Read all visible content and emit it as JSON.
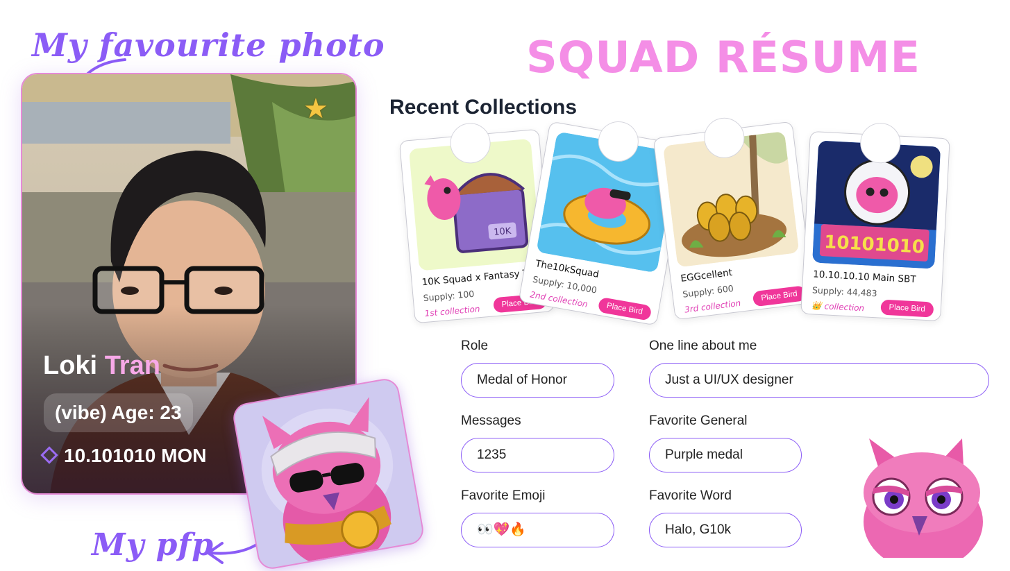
{
  "annotations": {
    "favourite_photo": "My favourite photo",
    "pfp": "My pfp"
  },
  "page_title": "SQUAD RÉSUME",
  "profile": {
    "first_name": "Loki",
    "last_name": "Tran",
    "age": "(vibe) Age: 23",
    "mon_balance": "10.101010 MON"
  },
  "collections": {
    "heading": "Recent Collections",
    "items": [
      {
        "name": "10K Squad x Fantasy To",
        "supply": "Supply: 100",
        "tag": "1st collection",
        "button": "Place Bird"
      },
      {
        "name": "The10kSquad",
        "supply": "Supply: 10,000",
        "tag": "2nd collection",
        "button": "Place Bird"
      },
      {
        "name": "EGGcellent",
        "supply": "Supply: 600",
        "tag": "3rd collection",
        "button": "Place Bird"
      },
      {
        "name": "10.10.10.10 Main SBT",
        "supply": "Supply: 44,483",
        "tag": "👑 collection",
        "button": "Place Bird"
      }
    ]
  },
  "form": {
    "role": {
      "label": "Role",
      "value": "Medal of Honor"
    },
    "about": {
      "label": "One line about me",
      "value": "Just a UI/UX designer"
    },
    "messages": {
      "label": "Messages",
      "value": "1235"
    },
    "general": {
      "label": "Favorite General",
      "value": "Purple medal"
    },
    "emoji": {
      "label": "Favorite Emoji",
      "value": "👀💖🔥"
    },
    "word": {
      "label": "Favorite Word",
      "value": "Halo, G10k"
    }
  },
  "sbt_art_text": "10101010",
  "chest_art_text": "10K",
  "colors": {
    "accent": "#8b5cf6",
    "title_pink": "#f48ee6",
    "button_pink": "#f0369a"
  }
}
